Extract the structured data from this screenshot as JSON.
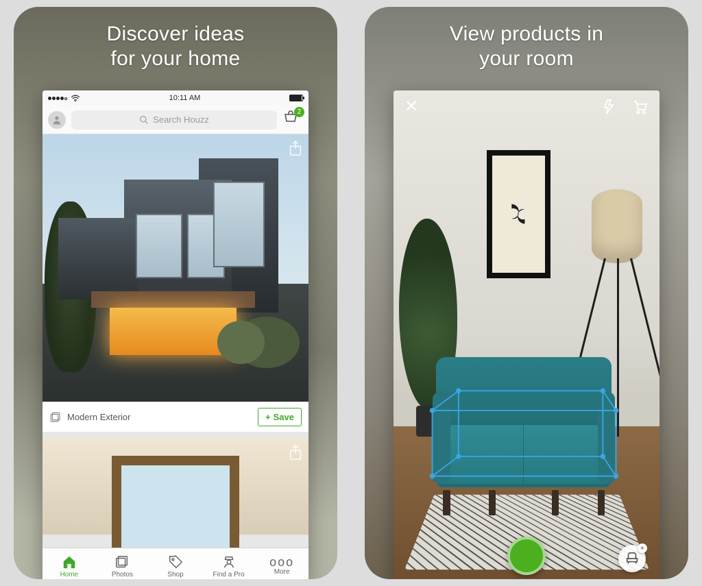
{
  "left": {
    "headline1": "Discover ideas",
    "headline2": "for your home",
    "status": {
      "time": "10:11 AM"
    },
    "topbar": {
      "search_placeholder": "Search Houzz",
      "cart_badge": "2"
    },
    "card": {
      "title": "Modern Exterior",
      "save_label": "Save"
    },
    "tabs": [
      {
        "label": "Home"
      },
      {
        "label": "Photos"
      },
      {
        "label": "Shop"
      },
      {
        "label": "Find a Pro"
      },
      {
        "label": "More"
      }
    ]
  },
  "right": {
    "headline1": "View products in",
    "headline2": "your room"
  }
}
